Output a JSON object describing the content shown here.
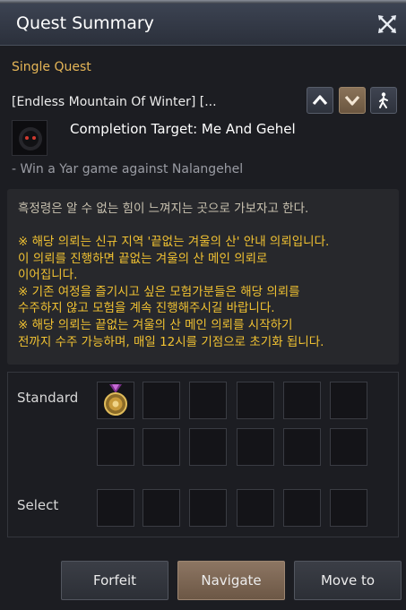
{
  "window": {
    "title": "Quest Summary",
    "close_icon": "crossed-swords-close-icon"
  },
  "quest": {
    "type": "Single Quest",
    "name": "[Endless Mountain Of Winter] [...",
    "completion_target": "Completion Target: Me And Gehel",
    "objective": "- Win a Yar game against Nalangehel"
  },
  "description": {
    "line1": "흑정령은 알 수 없는 힘이 느껴지는 곳으로 가보자고 한다.",
    "notice_lines": [
      "※ 해당 의뢰는 신규 지역 '끝없는 겨울의 산' 안내 의뢰입니다.",
      "이 의뢰를 진행하면 끝없는 겨울의 산 메인 의뢰로",
      "이어집니다.",
      "※ 기존 여정을 즐기시고 싶은 모험가분들은 해당 의뢰를",
      "수주하지 않고 모험을 계속 진행해주시길 바랍니다.",
      "※ 해당 의뢰는 끝없는 겨울의 산 메인 의뢰를 시작하기",
      "전까지 수주 가능하며, 매일 12시를 기점으로 초기화 됩니다."
    ],
    "notice_color": "#f1c232"
  },
  "rewards": {
    "standard_label": "Standard",
    "select_label": "Select",
    "standard_item_icon": "medal-icon"
  },
  "buttons": {
    "forfeit": "Forfeit",
    "navigate": "Navigate",
    "move_to": "Move to"
  },
  "colors": {
    "accent_gold": "#e6b657",
    "navigate_bg": "#7c6654"
  }
}
